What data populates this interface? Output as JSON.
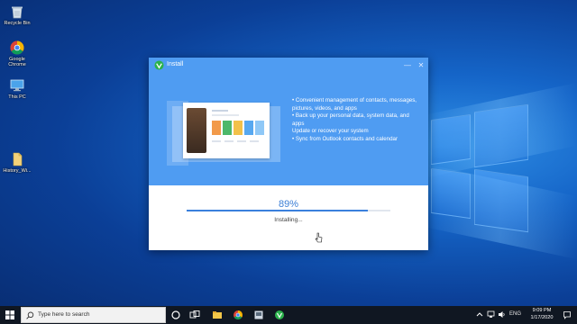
{
  "desktop": {
    "icons": [
      {
        "label": "Recycle Bin",
        "icon": "recycle-bin-icon"
      },
      {
        "label": "Google\nChrome",
        "icon": "chrome-icon"
      },
      {
        "label": "This PC",
        "icon": "this-pc-icon"
      },
      {
        "label": "History_Wi...",
        "icon": "file-icon"
      }
    ]
  },
  "window": {
    "title": "Install",
    "minimize_glyph": "—",
    "close_glyph": "✕",
    "features": [
      "• Convenient management of contacts, messages, pictures, videos, and apps",
      "• Back up your personal data, system data, and apps",
      "Update or recover your system",
      "• Sync from Outlook contacts and calendar"
    ],
    "progress": {
      "percent_label": "89%",
      "fraction": 0.89,
      "status": "Installing..."
    }
  },
  "taskbar": {
    "search_placeholder": "Type here to search",
    "tray_lang": "ENG",
    "time": "9:09 PM",
    "date": "1/17/2020"
  },
  "colors": {
    "window_accent": "#4f9cf2",
    "progress_fill": "#3a80dc",
    "percent_text": "#3c7fd6"
  }
}
